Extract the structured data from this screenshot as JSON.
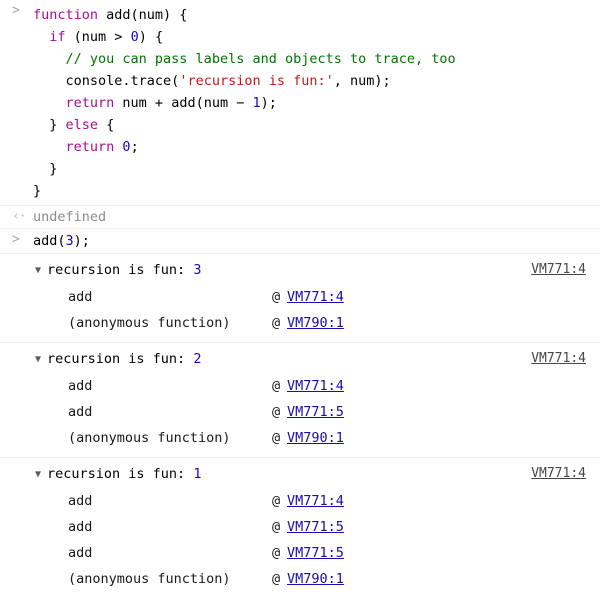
{
  "console": {
    "prompt_marker": ">",
    "output_marker": "‹·",
    "twisty_expanded": "▼",
    "at_symbol": "@",
    "colors": {
      "keyword": "#aa0d91",
      "number": "#1c00cf",
      "string": "#c41a16",
      "comment": "#007400",
      "link": "#1a0dab",
      "muted": "#8c8c8c",
      "background": "#ffffff",
      "separator": "#f0f0f0"
    }
  },
  "input_source": {
    "lines": [
      [
        {
          "t": "function ",
          "c": "kw"
        },
        {
          "t": "add(num) {",
          "c": "plain"
        }
      ],
      [
        {
          "t": "  ",
          "c": "plain"
        },
        {
          "t": "if ",
          "c": "kw"
        },
        {
          "t": "(num > ",
          "c": "plain"
        },
        {
          "t": "0",
          "c": "num"
        },
        {
          "t": ") {",
          "c": "plain"
        }
      ],
      [
        {
          "t": "    ",
          "c": "plain"
        },
        {
          "t": "// you can pass labels and objects to trace, too",
          "c": "com"
        }
      ],
      [
        {
          "t": "    console.trace(",
          "c": "plain"
        },
        {
          "t": "'recursion is fun:'",
          "c": "str"
        },
        {
          "t": ", num);",
          "c": "plain"
        }
      ],
      [
        {
          "t": "    ",
          "c": "plain"
        },
        {
          "t": "return ",
          "c": "kw"
        },
        {
          "t": "num + add(num − ",
          "c": "plain"
        },
        {
          "t": "1",
          "c": "num"
        },
        {
          "t": ");",
          "c": "plain"
        }
      ],
      [
        {
          "t": "  } ",
          "c": "plain"
        },
        {
          "t": "else ",
          "c": "kw"
        },
        {
          "t": "{",
          "c": "plain"
        }
      ],
      [
        {
          "t": "    ",
          "c": "plain"
        },
        {
          "t": "return ",
          "c": "kw"
        },
        {
          "t": "0",
          "c": "num"
        },
        {
          "t": ";",
          "c": "plain"
        }
      ],
      [
        {
          "t": "  }",
          "c": "plain"
        }
      ],
      [
        {
          "t": "}",
          "c": "plain"
        }
      ]
    ]
  },
  "result": {
    "value": "undefined"
  },
  "second_input": {
    "lines": [
      [
        {
          "t": "add(",
          "c": "plain"
        },
        {
          "t": "3",
          "c": "num"
        },
        {
          "t": ");",
          "c": "plain"
        }
      ]
    ]
  },
  "traces": [
    {
      "label": "recursion is fun: ",
      "arg": "3",
      "source_link": "VM771:4",
      "frames": [
        {
          "fn": "add",
          "link": "VM771:4"
        },
        {
          "fn": "(anonymous function)",
          "link": "VM790:1"
        }
      ]
    },
    {
      "label": "recursion is fun: ",
      "arg": "2",
      "source_link": "VM771:4",
      "frames": [
        {
          "fn": "add",
          "link": "VM771:4"
        },
        {
          "fn": "add",
          "link": "VM771:5"
        },
        {
          "fn": "(anonymous function)",
          "link": "VM790:1"
        }
      ]
    },
    {
      "label": "recursion is fun: ",
      "arg": "1",
      "source_link": "VM771:4",
      "frames": [
        {
          "fn": "add",
          "link": "VM771:4"
        },
        {
          "fn": "add",
          "link": "VM771:5"
        },
        {
          "fn": "add",
          "link": "VM771:5"
        },
        {
          "fn": "(anonymous function)",
          "link": "VM790:1"
        }
      ]
    }
  ]
}
